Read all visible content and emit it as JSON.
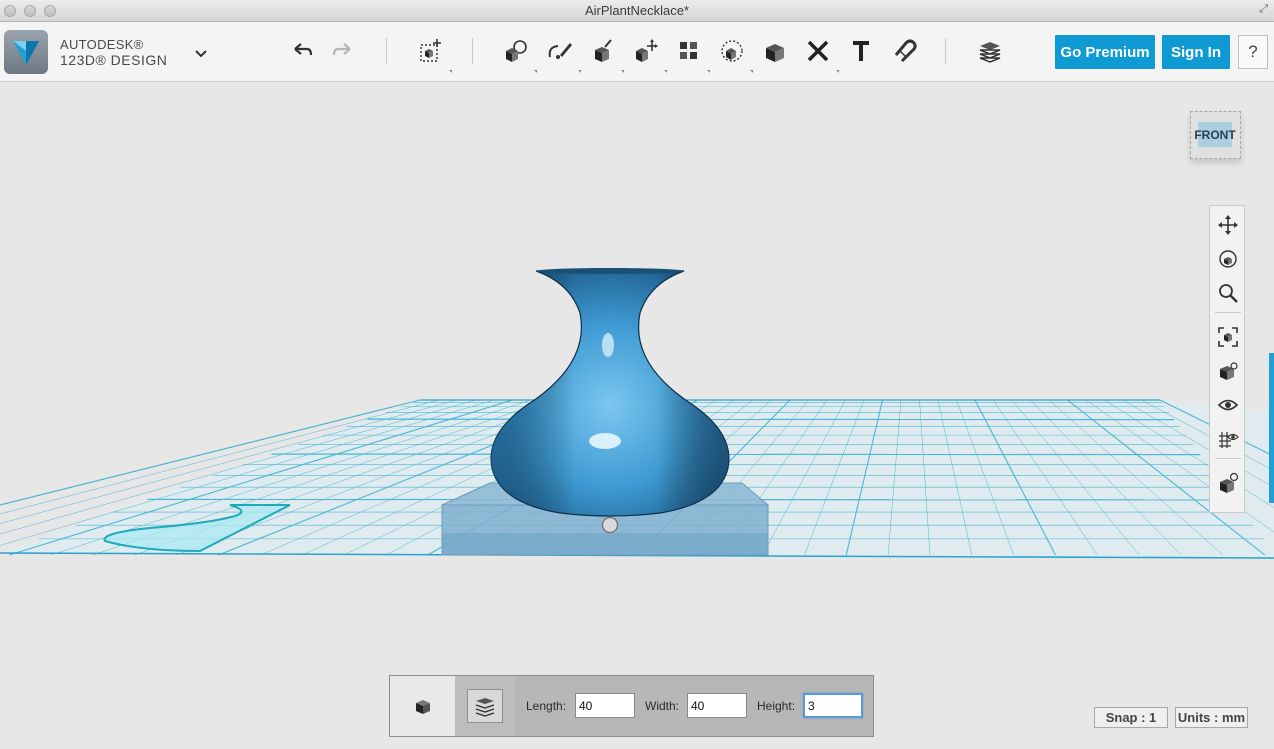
{
  "window": {
    "title": "AirPlantNecklace*"
  },
  "brand": {
    "line1": "AUTODESK®",
    "line2": "123D® DESIGN"
  },
  "toolbar": {
    "go_premium": "Go Premium",
    "sign_in": "Sign In",
    "help": "?",
    "tools": [
      "undo",
      "redo",
      "transform",
      "primitives",
      "sketch",
      "construct",
      "modify",
      "pattern",
      "grouping",
      "combine",
      "measure",
      "text",
      "snap",
      "material"
    ]
  },
  "viewcube": {
    "label": "FRONT"
  },
  "navbar": {
    "items": [
      "pan-icon",
      "orbit-icon",
      "zoom-icon",
      "fit-icon",
      "views-icon",
      "visibility-icon",
      "grid-visibility-icon",
      "material-icon"
    ]
  },
  "dimensions": {
    "length_label": "Length:",
    "length_value": "40",
    "width_label": "Width:",
    "width_value": "40",
    "height_label": "Height:",
    "height_value": "3"
  },
  "status": {
    "snap": "Snap : 1",
    "units": "Units : mm"
  },
  "colors": {
    "accent": "#0f9ad4",
    "model": "#4aa8dc",
    "grid": "#4ab6d6"
  }
}
